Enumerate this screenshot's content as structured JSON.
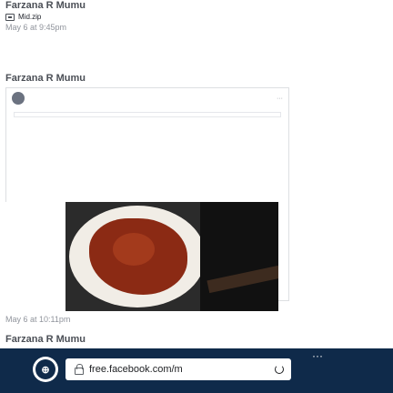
{
  "messages": [
    {
      "sender": "Farzana R Mumu",
      "attachment": "Mid.zip",
      "time": "May 6 at 9:45pm"
    },
    {
      "sender": "Farzana R Mumu",
      "time": "May 6 at 10:11pm"
    },
    {
      "sender": "Farzana R Mumu"
    }
  ],
  "browser_bar": {
    "url": "free.facebook.com/m"
  },
  "colors": {
    "sender_text": "#4b4f56",
    "timestamp": "#90949c",
    "overlay_bg": "#0f2a4a",
    "url_pill_bg": "#ffffff"
  },
  "icons": {
    "attachment": "file-icon",
    "url": "lock-icon",
    "reload": "reload-icon",
    "more": "more-icon",
    "logo": "app-logo-icon"
  }
}
